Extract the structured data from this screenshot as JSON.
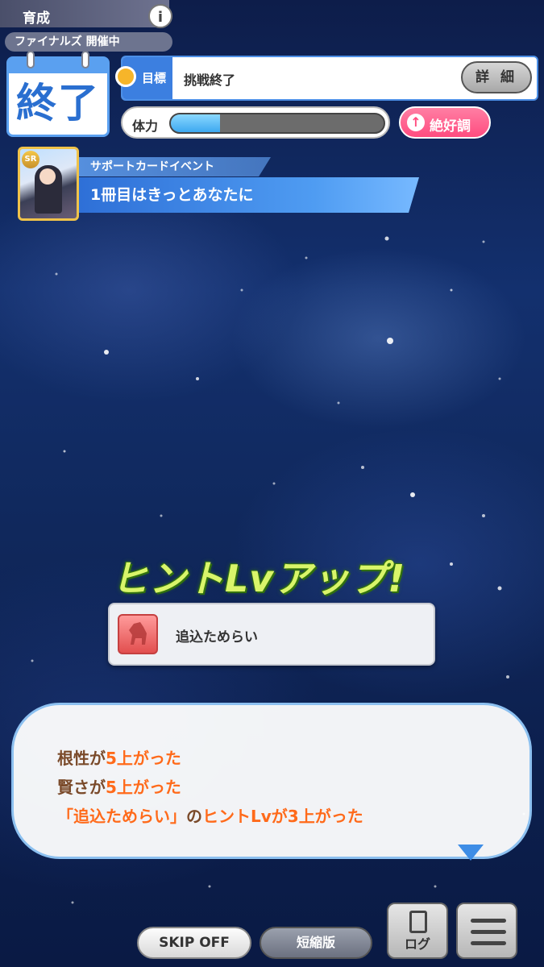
{
  "header": {
    "screen_label": "育成",
    "info_label": "i",
    "phase_label": "ファイナルズ 開催中",
    "calendar_text": "終了"
  },
  "goal": {
    "label": "目標",
    "value": "挑戦終了",
    "detail_label": "詳 細"
  },
  "stamina": {
    "label": "体力",
    "fill_fraction": 0.23
  },
  "mood": {
    "label": "絶好調",
    "icon": "up-arrow-icon"
  },
  "event": {
    "category": "サポートカードイベント",
    "title": "1冊目はきっとあなたに",
    "card_rarity": "SR"
  },
  "hint": {
    "title": "ヒントLvアップ!",
    "skill_name": "追込ためらい",
    "skill_icon": "horse-debuff-icon"
  },
  "dialog": {
    "line1": {
      "p1": "根性が",
      "hl": "5上がった"
    },
    "line2": {
      "p1": "賢さが",
      "hl": "5上がった"
    },
    "line3": {
      "hl1": "「追込ためらい」",
      "p1": "の",
      "hl2": "ヒントLvが3上がった"
    }
  },
  "controls": {
    "skip_label": "SKIP OFF",
    "short_label": "短縮版",
    "log_label": "ログ"
  },
  "colors": {
    "accent_blue": "#3c7fe0",
    "mood_pink": "#ff4c7f",
    "hint_green": "#d9f56a",
    "dialog_highlight": "#ff6a1a"
  }
}
